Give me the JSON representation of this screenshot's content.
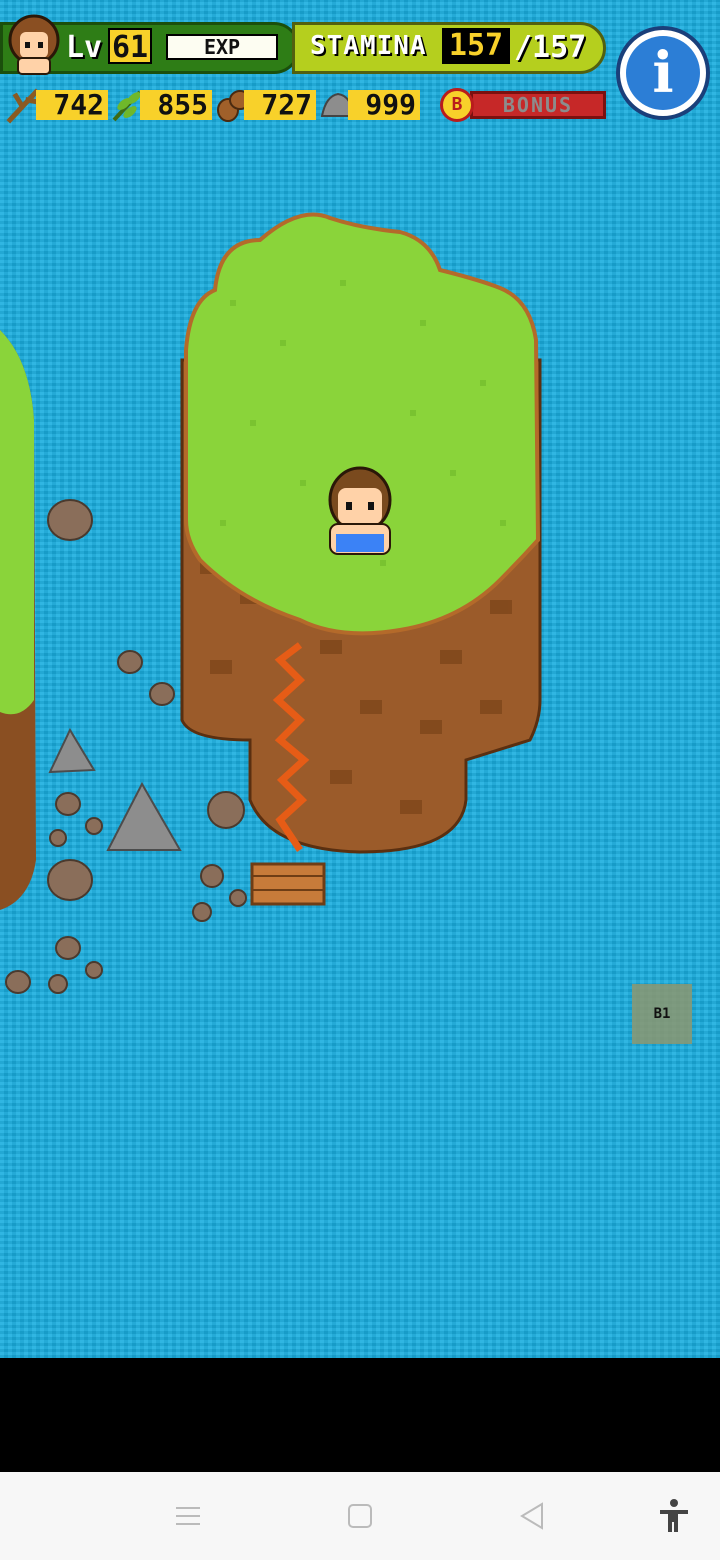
{
  "hud": {
    "level_label": "Lv",
    "level_value": "61",
    "exp_label": "EXP",
    "stamina_label": "STAMINA",
    "stamina_current": "157",
    "stamina_max": "/157",
    "info_symbol": "i",
    "resources": [
      {
        "name": "branch-icon",
        "value": "742"
      },
      {
        "name": "herb-icon",
        "value": "855"
      },
      {
        "name": "acorn-icon",
        "value": "727"
      },
      {
        "name": "stone-icon",
        "value": "999"
      }
    ],
    "bonus_badge": "B",
    "bonus_label": "BONUS"
  },
  "map": {
    "floor_label": "B1"
  },
  "navbar": {
    "icons": [
      "menu-icon",
      "home-square-icon",
      "back-triangle-icon",
      "accessibility-icon"
    ]
  },
  "colors": {
    "sea": "#19aee0",
    "grass": "#8ad43a",
    "dirt": "#9b5b2a",
    "hud_yellow": "#f8d12a"
  }
}
